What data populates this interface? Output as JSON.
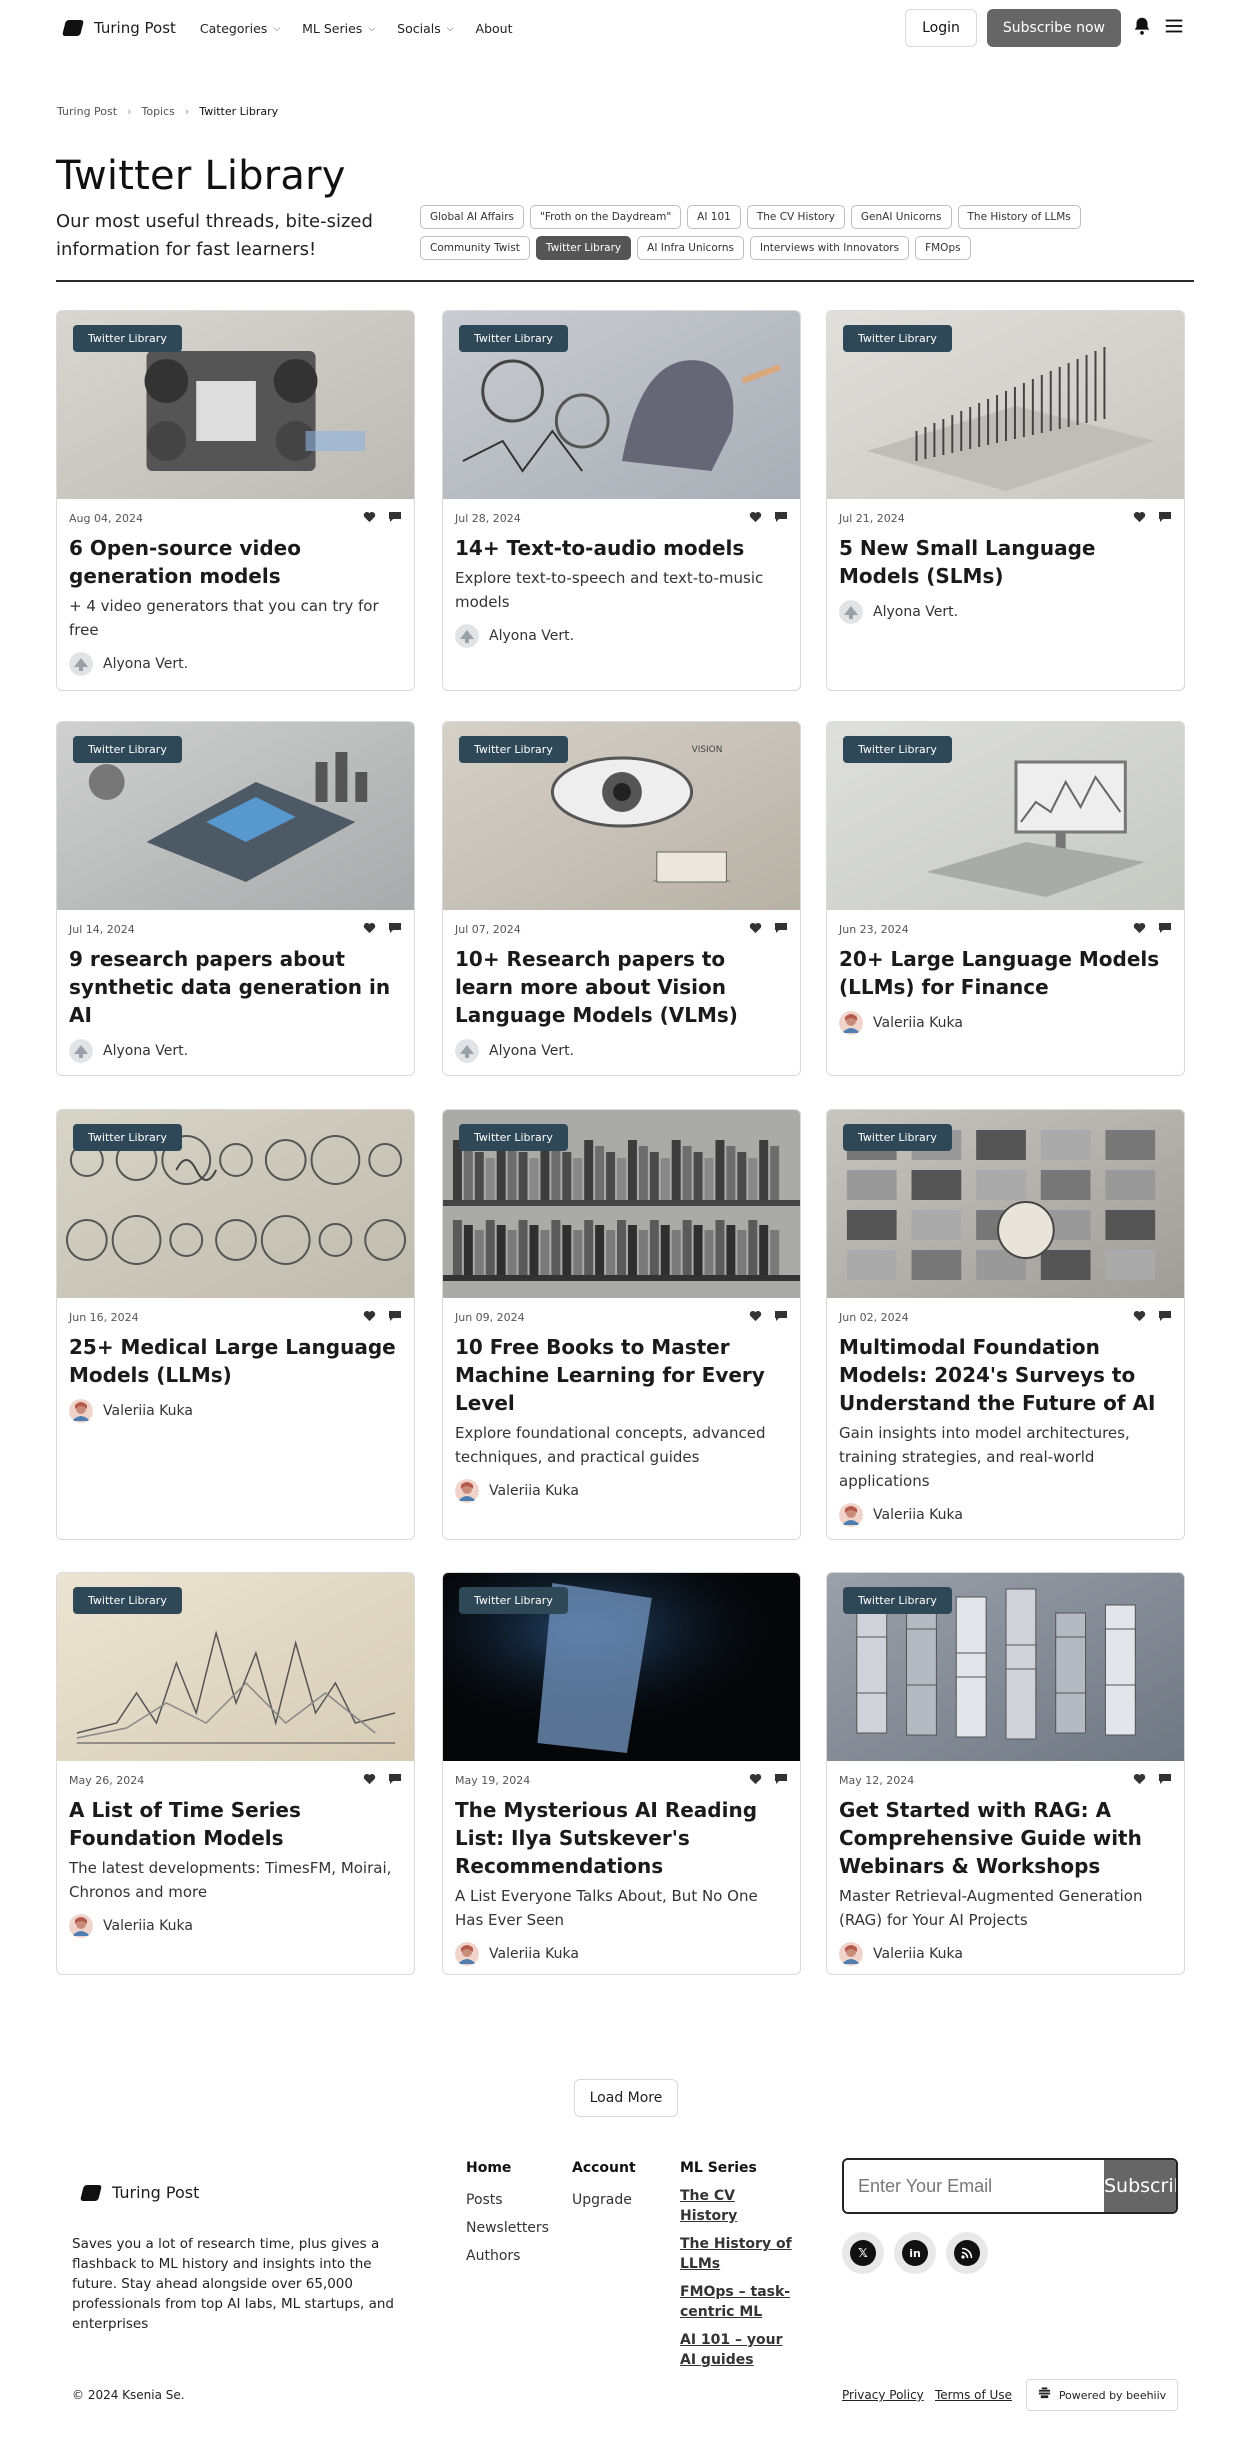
{
  "nav": {
    "brand": "Turing Post",
    "menu": [
      {
        "label": "Categories",
        "dropdown": true
      },
      {
        "label": "ML Series",
        "dropdown": true
      },
      {
        "label": "Socials",
        "dropdown": true
      },
      {
        "label": "About",
        "dropdown": false
      }
    ],
    "login": "Login",
    "subscribe": "Subscribe now"
  },
  "breadcrumb": [
    "Turing Post",
    "Topics",
    "Twitter Library"
  ],
  "page": {
    "title": "Twitter Library",
    "subtitle": "Our most useful threads, bite-sized information for fast learners!"
  },
  "tags": [
    {
      "label": "Global AI Affairs",
      "active": false
    },
    {
      "label": "\"Froth on the Daydream\"",
      "active": false
    },
    {
      "label": "AI 101",
      "active": false
    },
    {
      "label": "The CV History",
      "active": false
    },
    {
      "label": "GenAI Unicorns",
      "active": false
    },
    {
      "label": "The History of LLMs",
      "active": false
    },
    {
      "label": "Community Twist",
      "active": false
    },
    {
      "label": "Twitter Library",
      "active": true
    },
    {
      "label": "AI Infra Unicorns",
      "active": false
    },
    {
      "label": "Interviews with Innovators",
      "active": false
    },
    {
      "label": "FMOps",
      "active": false
    }
  ],
  "posts": [
    {
      "badge": "Twitter Library",
      "date": "Aug 04, 2024",
      "title": "6 Open-source video generation models",
      "desc": "+ 4 video generators that you can try for free",
      "author": "Alyona Vert.",
      "image": "gears-machine"
    },
    {
      "badge": "Twitter Library",
      "date": "Jul 28, 2024",
      "title": "14+ Text-to-audio models",
      "desc": "Explore text-to-speech and text-to-music models",
      "author": "Alyona Vert.",
      "image": "audio-head"
    },
    {
      "badge": "Twitter Library",
      "date": "Jul 21, 2024",
      "title": "5 New Small Language Models (SLMs)",
      "desc": "",
      "author": "Alyona Vert.",
      "image": "isometric-graph"
    },
    {
      "badge": "Twitter Library",
      "date": "Jul 14, 2024",
      "title": "9 research papers about synthetic data generation in AI",
      "desc": "",
      "author": "Alyona Vert.",
      "image": "data-board"
    },
    {
      "badge": "Twitter Library",
      "date": "Jul 07, 2024",
      "title": "10+ Research papers to learn more about Vision Language Models (VLMs)",
      "desc": "",
      "author": "Alyona Vert.",
      "image": "eye-book"
    },
    {
      "badge": "Twitter Library",
      "date": "Jun 23, 2024",
      "title": "20+ Large Language Models (LLMs) for Finance",
      "desc": "",
      "author": "Valeriia Kuka",
      "image": "finance-desk"
    },
    {
      "badge": "Twitter Library",
      "date": "Jun 16, 2024",
      "title": "25+ Medical Large Language Models (LLMs)",
      "desc": "",
      "author": "Valeriia Kuka",
      "image": "medical-collage"
    },
    {
      "badge": "Twitter Library",
      "date": "Jun 09, 2024",
      "title": "10 Free Books to Master Machine Learning for Every Level",
      "desc": "Explore foundational concepts, advanced techniques, and practical guides",
      "author": "Valeriia Kuka",
      "image": "bookshelf"
    },
    {
      "badge": "Twitter Library",
      "date": "Jun 02, 2024",
      "title": "Multimodal Foundation Models: 2024's Surveys to Understand the Future of AI",
      "desc": "Gain insights into model architectures, training strategies, and real-world applications",
      "author": "Valeriia Kuka",
      "image": "multimodal-collage"
    },
    {
      "badge": "Twitter Library",
      "date": "May 26, 2024",
      "title": "A List of Time Series Foundation Models",
      "desc": "The latest developments: TimesFM, Moirai, Chronos and more",
      "author": "Valeriia Kuka",
      "image": "time-series"
    },
    {
      "badge": "Twitter Library",
      "date": "May 19, 2024",
      "title": "The Mysterious AI Reading List: Ilya Sutskever's Recommendations",
      "desc": "A List Everyone Talks About, But No One Has Ever Seen",
      "author": "Valeriia Kuka",
      "image": "dark-paper"
    },
    {
      "badge": "Twitter Library",
      "date": "May 12, 2024",
      "title": "Get Started with RAG: A Comprehensive Guide with Webinars & Workshops",
      "desc": "Master Retrieval-Augmented Generation (RAG) for Your AI Projects",
      "author": "Valeriia Kuka",
      "image": "isometric-city"
    }
  ],
  "load_more": "Load More",
  "footer": {
    "brand": "Turing Post",
    "about": "Saves you a lot of research time, plus gives a flashback to ML history and insights into the future. Stay ahead alongside over 65,000 professionals from top AI labs, ML startups, and enterprises",
    "home": {
      "head": "Home",
      "links": [
        "Posts",
        "Newsletters",
        "Authors"
      ]
    },
    "account": {
      "head": "Account",
      "links": [
        "Upgrade"
      ]
    },
    "ml_series": {
      "head": "ML Series",
      "links": [
        "The CV History",
        "The History of LLMs",
        "FMOps – task-centric ML",
        "AI 101 – your AI guides"
      ]
    },
    "email_placeholder": "Enter Your Email",
    "subscribe": "Subscribe",
    "socials": [
      "x-icon",
      "linkedin-icon",
      "rss-icon"
    ],
    "copyright": "© 2024 Ksenia Se.",
    "privacy": "Privacy Policy",
    "terms": "Terms of Use",
    "powered": "Powered by beehiiv"
  },
  "colors": {
    "badge": "#2f4858",
    "primary_button": "#666666",
    "active_tag": "#555555"
  }
}
